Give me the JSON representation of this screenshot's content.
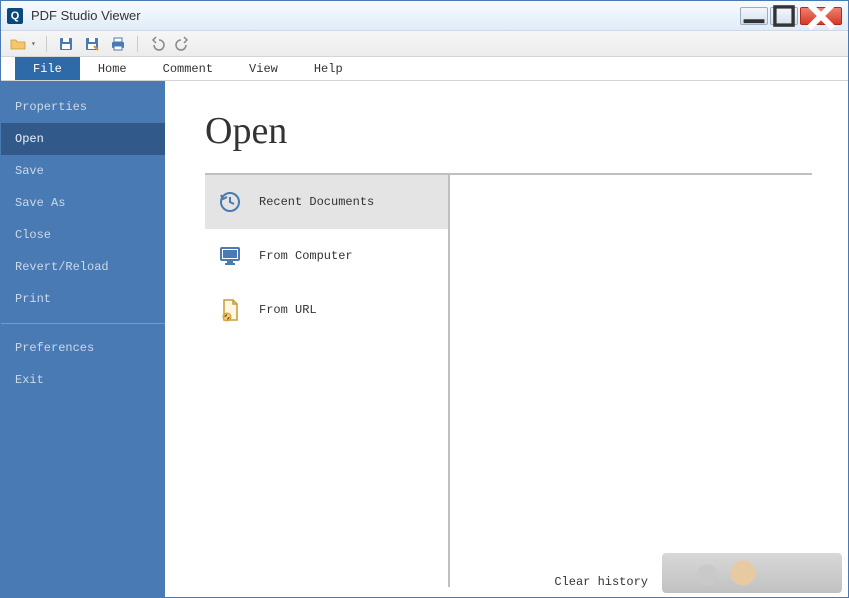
{
  "window": {
    "title": "PDF Studio Viewer",
    "app_icon_glyph": "Q"
  },
  "tabs": {
    "file": "File",
    "home": "Home",
    "comment": "Comment",
    "view": "View",
    "help": "Help"
  },
  "sidebar": {
    "properties": "Properties",
    "open": "Open",
    "save": "Save",
    "save_as": "Save As",
    "close": "Close",
    "revert": "Revert/Reload",
    "print": "Print",
    "preferences": "Preferences",
    "exit": "Exit"
  },
  "content": {
    "title": "Open",
    "options": {
      "recent": "Recent Documents",
      "from_computer": "From Computer",
      "from_url": "From URL"
    },
    "clear_history": "Clear history"
  }
}
